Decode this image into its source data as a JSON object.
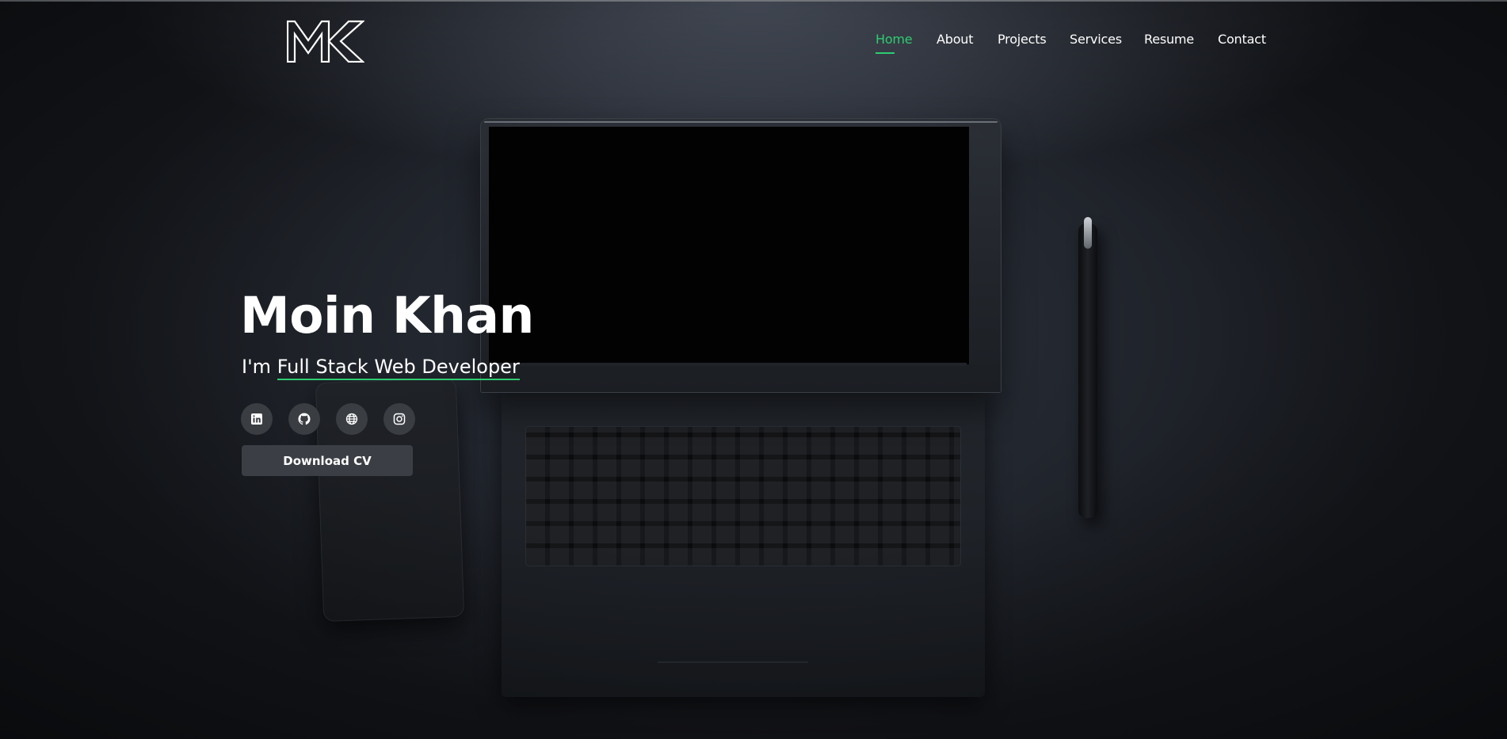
{
  "brand": {
    "logo_text": "MK",
    "accent_color": "#2ecc71"
  },
  "nav": {
    "items": [
      {
        "label": "Home",
        "active": true
      },
      {
        "label": "About",
        "active": false
      },
      {
        "label": "Projects",
        "active": false
      },
      {
        "label": "Services",
        "active": false
      },
      {
        "label": "Resume",
        "active": false
      },
      {
        "label": "Contact",
        "active": false
      }
    ]
  },
  "hero": {
    "name": "Moin Khan",
    "tagline_prefix": "I'm ",
    "tagline_role": "Full Stack Web Developer",
    "socials": [
      {
        "icon": "linkedin-icon"
      },
      {
        "icon": "github-icon"
      },
      {
        "icon": "globe-icon"
      },
      {
        "icon": "instagram-icon"
      }
    ],
    "cta_label": "Download CV"
  }
}
